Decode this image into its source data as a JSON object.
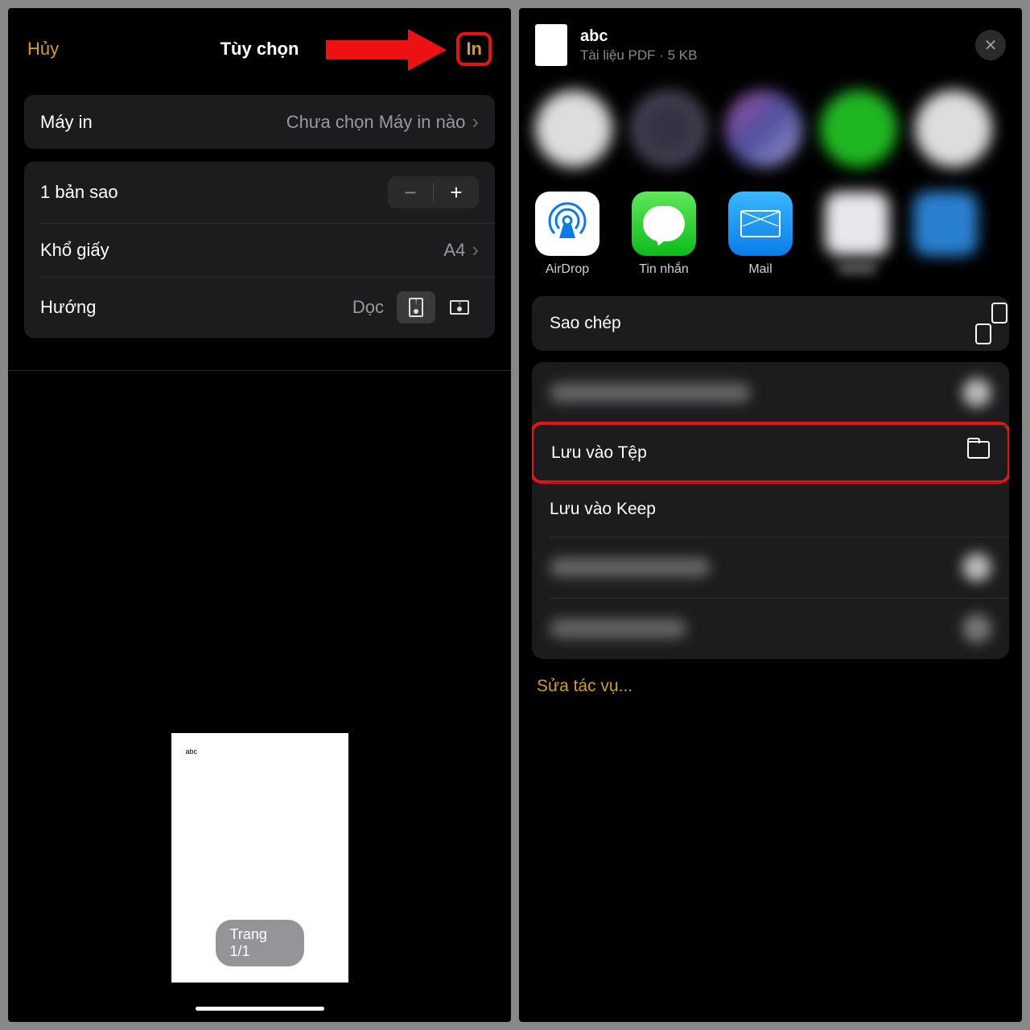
{
  "left": {
    "cancel": "Hủy",
    "title": "Tùy chọn",
    "print": "In",
    "printer_label": "Máy in",
    "printer_value": "Chưa chọn Máy in nào",
    "copies_label": "1 bản sao",
    "paper_label": "Khổ giấy",
    "paper_value": "A4",
    "orientation_label": "Hướng",
    "orientation_value": "Dọc",
    "doc_text": "abc",
    "page_indicator": "Trang 1/1"
  },
  "right": {
    "file_name": "abc",
    "file_sub": "Tài liệu PDF · 5 KB",
    "apps": {
      "airdrop": "AirDrop",
      "messages": "Tin nhắn",
      "mail": "Mail"
    },
    "actions": {
      "copy": "Sao chép",
      "save_files": "Lưu vào Tệp",
      "save_keep": "Lưu vào Keep"
    },
    "edit": "Sửa tác vụ..."
  }
}
